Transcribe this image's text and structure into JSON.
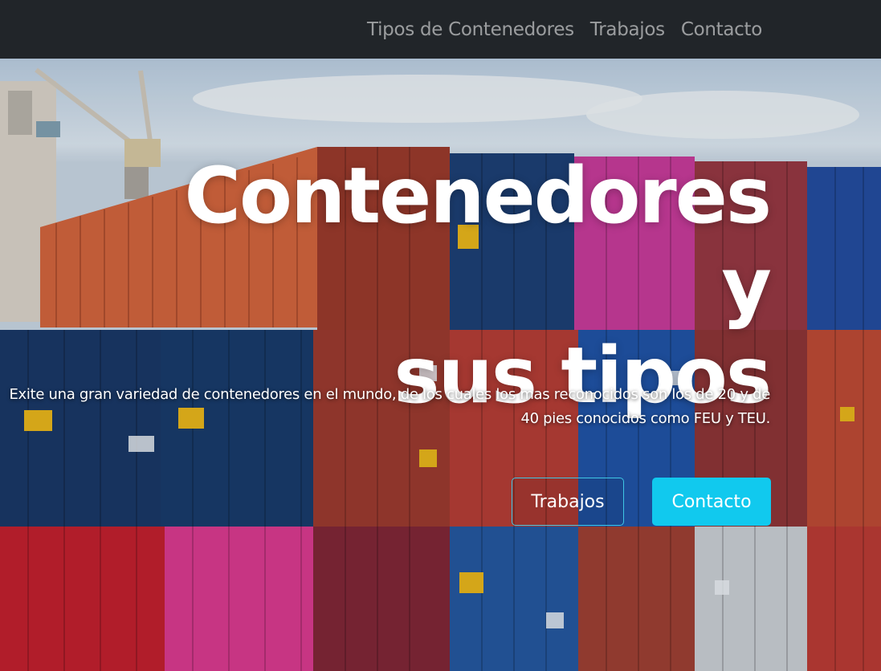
{
  "nav": {
    "items": [
      {
        "label": "Tipos de Contenedores"
      },
      {
        "label": "Trabajos"
      },
      {
        "label": "Contacto"
      }
    ]
  },
  "hero": {
    "title_line1": "Contenedores y",
    "title_line2": "sus tipos",
    "description": "Exite una gran variedad de contenedores en el mundo, de los cuales los mas reconocidos son los de 20 y de 40 pies conocidos como FEU y TEU.",
    "buttons": {
      "primary": "Trabajos",
      "secondary": "Contacto"
    },
    "colors": {
      "navbar": "#212529",
      "button_outline": "#3fc6e4",
      "button_solid": "#11c9ee"
    }
  }
}
